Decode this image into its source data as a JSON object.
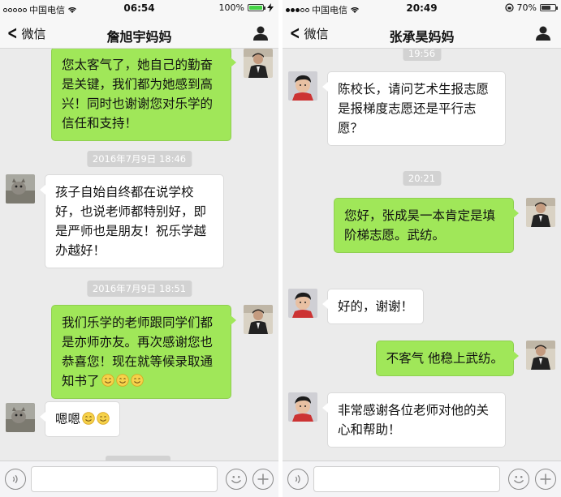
{
  "left": {
    "status": {
      "carrier": "中国电信",
      "time": "06:54",
      "battery": "100%",
      "battery_color": "#44d345"
    },
    "nav": {
      "back_label": "微信",
      "title": "詹旭宇妈妈"
    },
    "messages": [
      {
        "kind": "sent",
        "text": "您太客气了，她自己的勤奋是关键，我们都为她感到高兴！同时也谢谢您对乐学的信任和支持！"
      },
      {
        "kind": "time",
        "text": "2016年7月9日 18:46"
      },
      {
        "kind": "received",
        "text": "孩子自始自终都在说学校好，也说老师都特别好，即是严师也是朋友！祝乐学越办越好！"
      },
      {
        "kind": "time",
        "text": "2016年7月9日 18:51"
      },
      {
        "kind": "sent",
        "text": "我们乐学的老师跟同学们都是亦师亦友。再次感谢您也恭喜您！现在就等候录取通知书了"
      },
      {
        "kind": "received",
        "text": "嗯嗯"
      }
    ]
  },
  "right": {
    "status": {
      "carrier": "中国电信",
      "time": "20:49",
      "battery": "70%",
      "battery_color": "#333333"
    },
    "nav": {
      "back_label": "微信",
      "title": "张承昊妈妈"
    },
    "messages": [
      {
        "kind": "time",
        "text": "19:56"
      },
      {
        "kind": "received",
        "text": "陈校长，请问艺术生报志愿是报梯度志愿还是平行志愿？"
      },
      {
        "kind": "time",
        "text": "20:21"
      },
      {
        "kind": "sent",
        "text": "您好，张成昊一本肯定是填阶梯志愿。武纺。"
      },
      {
        "kind": "received",
        "text": "好的，谢谢！"
      },
      {
        "kind": "sent",
        "text": "不客气 他稳上武纺。"
      },
      {
        "kind": "received",
        "text": "非常感谢各位老师对他的关心和帮助！"
      }
    ]
  },
  "colors": {
    "sent_bubble": "#a0e759",
    "received_bubble": "#ffffff",
    "chat_bg": "#ebebeb"
  },
  "icons": [
    "chevron-left-icon",
    "person-icon",
    "voice-icon",
    "emoji-icon",
    "plus-icon",
    "wifi-icon",
    "battery-icon",
    "smile-emoji-icon"
  ]
}
